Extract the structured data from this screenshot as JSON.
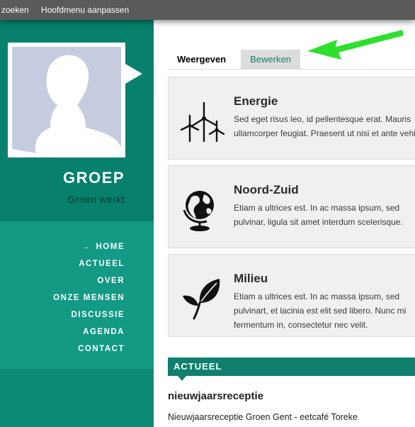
{
  "topbar": {
    "item_search": "zoeken",
    "item_menu": "Hoofdmenu aanpassen"
  },
  "sidebar": {
    "group_name": "GROEP",
    "group_subtitle": "Groen werkt",
    "nav": [
      {
        "label": "HOME",
        "active": true,
        "marker": "→"
      },
      {
        "label": "ACTUEEL"
      },
      {
        "label": "OVER"
      },
      {
        "label": "ONZE MENSEN"
      },
      {
        "label": "DISCUSSIE"
      },
      {
        "label": "AGENDA"
      },
      {
        "label": "CONTACT"
      }
    ]
  },
  "tabs": {
    "view": "Weergeven",
    "edit": "Bewerken"
  },
  "cards": [
    {
      "title": "Energie",
      "icon": "wind-turbine-icon",
      "lines": [
        "Sed eget risus leo, id pellentesque erat. Mauris",
        "ullamcorper feugiat. Praesent ut nisi et ante vehicula"
      ]
    },
    {
      "title": "Noord-Zuid",
      "icon": "globe-icon",
      "lines": [
        "Etiam a ultrices est. In ac massa ipsum, sed",
        "pulvinar, ligula sit amet interdum scelerisque."
      ]
    },
    {
      "title": "Milieu",
      "icon": "leaf-icon",
      "lines": [
        "Etiam a ultrices est. In ac massa ipsum, sed",
        "pulvinart, et lacinia est elit sed libero. Nunc mi",
        "fermentum in, consectetur nec velit."
      ]
    }
  ],
  "actueel": {
    "heading": "ACTUEEL",
    "news_title": "nieuwjaarsreceptie",
    "news_text": "Nieuwjaarsreceptie Groen Gent - eetcafé Toreke"
  },
  "colors": {
    "sidebar": "#0f8a77",
    "accent": "#10806e",
    "annotation_arrow": "#2ee02e"
  }
}
